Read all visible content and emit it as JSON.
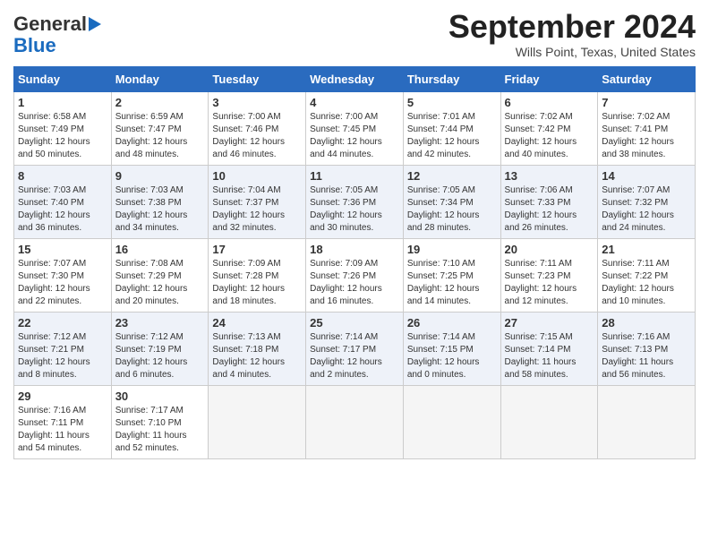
{
  "header": {
    "logo_line1": "General",
    "logo_line2": "Blue",
    "title": "September 2024",
    "location": "Wills Point, Texas, United States"
  },
  "columns": [
    "Sunday",
    "Monday",
    "Tuesday",
    "Wednesday",
    "Thursday",
    "Friday",
    "Saturday"
  ],
  "weeks": [
    [
      {
        "day": "1",
        "lines": [
          "Sunrise: 6:58 AM",
          "Sunset: 7:49 PM",
          "Daylight: 12 hours",
          "and 50 minutes."
        ]
      },
      {
        "day": "2",
        "lines": [
          "Sunrise: 6:59 AM",
          "Sunset: 7:47 PM",
          "Daylight: 12 hours",
          "and 48 minutes."
        ]
      },
      {
        "day": "3",
        "lines": [
          "Sunrise: 7:00 AM",
          "Sunset: 7:46 PM",
          "Daylight: 12 hours",
          "and 46 minutes."
        ]
      },
      {
        "day": "4",
        "lines": [
          "Sunrise: 7:00 AM",
          "Sunset: 7:45 PM",
          "Daylight: 12 hours",
          "and 44 minutes."
        ]
      },
      {
        "day": "5",
        "lines": [
          "Sunrise: 7:01 AM",
          "Sunset: 7:44 PM",
          "Daylight: 12 hours",
          "and 42 minutes."
        ]
      },
      {
        "day": "6",
        "lines": [
          "Sunrise: 7:02 AM",
          "Sunset: 7:42 PM",
          "Daylight: 12 hours",
          "and 40 minutes."
        ]
      },
      {
        "day": "7",
        "lines": [
          "Sunrise: 7:02 AM",
          "Sunset: 7:41 PM",
          "Daylight: 12 hours",
          "and 38 minutes."
        ]
      }
    ],
    [
      {
        "day": "8",
        "lines": [
          "Sunrise: 7:03 AM",
          "Sunset: 7:40 PM",
          "Daylight: 12 hours",
          "and 36 minutes."
        ]
      },
      {
        "day": "9",
        "lines": [
          "Sunrise: 7:03 AM",
          "Sunset: 7:38 PM",
          "Daylight: 12 hours",
          "and 34 minutes."
        ]
      },
      {
        "day": "10",
        "lines": [
          "Sunrise: 7:04 AM",
          "Sunset: 7:37 PM",
          "Daylight: 12 hours",
          "and 32 minutes."
        ]
      },
      {
        "day": "11",
        "lines": [
          "Sunrise: 7:05 AM",
          "Sunset: 7:36 PM",
          "Daylight: 12 hours",
          "and 30 minutes."
        ]
      },
      {
        "day": "12",
        "lines": [
          "Sunrise: 7:05 AM",
          "Sunset: 7:34 PM",
          "Daylight: 12 hours",
          "and 28 minutes."
        ]
      },
      {
        "day": "13",
        "lines": [
          "Sunrise: 7:06 AM",
          "Sunset: 7:33 PM",
          "Daylight: 12 hours",
          "and 26 minutes."
        ]
      },
      {
        "day": "14",
        "lines": [
          "Sunrise: 7:07 AM",
          "Sunset: 7:32 PM",
          "Daylight: 12 hours",
          "and 24 minutes."
        ]
      }
    ],
    [
      {
        "day": "15",
        "lines": [
          "Sunrise: 7:07 AM",
          "Sunset: 7:30 PM",
          "Daylight: 12 hours",
          "and 22 minutes."
        ]
      },
      {
        "day": "16",
        "lines": [
          "Sunrise: 7:08 AM",
          "Sunset: 7:29 PM",
          "Daylight: 12 hours",
          "and 20 minutes."
        ]
      },
      {
        "day": "17",
        "lines": [
          "Sunrise: 7:09 AM",
          "Sunset: 7:28 PM",
          "Daylight: 12 hours",
          "and 18 minutes."
        ]
      },
      {
        "day": "18",
        "lines": [
          "Sunrise: 7:09 AM",
          "Sunset: 7:26 PM",
          "Daylight: 12 hours",
          "and 16 minutes."
        ]
      },
      {
        "day": "19",
        "lines": [
          "Sunrise: 7:10 AM",
          "Sunset: 7:25 PM",
          "Daylight: 12 hours",
          "and 14 minutes."
        ]
      },
      {
        "day": "20",
        "lines": [
          "Sunrise: 7:11 AM",
          "Sunset: 7:23 PM",
          "Daylight: 12 hours",
          "and 12 minutes."
        ]
      },
      {
        "day": "21",
        "lines": [
          "Sunrise: 7:11 AM",
          "Sunset: 7:22 PM",
          "Daylight: 12 hours",
          "and 10 minutes."
        ]
      }
    ],
    [
      {
        "day": "22",
        "lines": [
          "Sunrise: 7:12 AM",
          "Sunset: 7:21 PM",
          "Daylight: 12 hours",
          "and 8 minutes."
        ]
      },
      {
        "day": "23",
        "lines": [
          "Sunrise: 7:12 AM",
          "Sunset: 7:19 PM",
          "Daylight: 12 hours",
          "and 6 minutes."
        ]
      },
      {
        "day": "24",
        "lines": [
          "Sunrise: 7:13 AM",
          "Sunset: 7:18 PM",
          "Daylight: 12 hours",
          "and 4 minutes."
        ]
      },
      {
        "day": "25",
        "lines": [
          "Sunrise: 7:14 AM",
          "Sunset: 7:17 PM",
          "Daylight: 12 hours",
          "and 2 minutes."
        ]
      },
      {
        "day": "26",
        "lines": [
          "Sunrise: 7:14 AM",
          "Sunset: 7:15 PM",
          "Daylight: 12 hours",
          "and 0 minutes."
        ]
      },
      {
        "day": "27",
        "lines": [
          "Sunrise: 7:15 AM",
          "Sunset: 7:14 PM",
          "Daylight: 11 hours",
          "and 58 minutes."
        ]
      },
      {
        "day": "28",
        "lines": [
          "Sunrise: 7:16 AM",
          "Sunset: 7:13 PM",
          "Daylight: 11 hours",
          "and 56 minutes."
        ]
      }
    ],
    [
      {
        "day": "29",
        "lines": [
          "Sunrise: 7:16 AM",
          "Sunset: 7:11 PM",
          "Daylight: 11 hours",
          "and 54 minutes."
        ]
      },
      {
        "day": "30",
        "lines": [
          "Sunrise: 7:17 AM",
          "Sunset: 7:10 PM",
          "Daylight: 11 hours",
          "and 52 minutes."
        ]
      },
      {
        "day": "",
        "lines": []
      },
      {
        "day": "",
        "lines": []
      },
      {
        "day": "",
        "lines": []
      },
      {
        "day": "",
        "lines": []
      },
      {
        "day": "",
        "lines": []
      }
    ]
  ]
}
